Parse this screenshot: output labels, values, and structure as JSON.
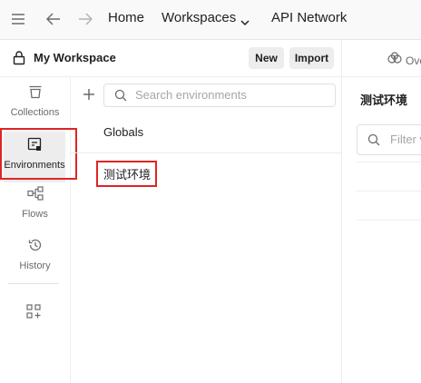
{
  "nav": {
    "home": "Home",
    "workspaces": "Workspaces",
    "api_network": "API Network"
  },
  "workspace": {
    "name": "My Workspace",
    "new_label": "New",
    "import_label": "Import"
  },
  "rail": {
    "items": [
      {
        "label": "Collections",
        "icon": "collections-icon"
      },
      {
        "label": "Environments",
        "icon": "environments-icon",
        "active": true
      },
      {
        "label": "Flows",
        "icon": "flows-icon"
      },
      {
        "label": "History",
        "icon": "history-icon"
      }
    ]
  },
  "search": {
    "placeholder": "Search environments"
  },
  "environments": {
    "items": [
      "Globals",
      "测试环境"
    ]
  },
  "right_panel": {
    "tab_label": "Ove",
    "title": "测试环境",
    "filter_placeholder": "Filter v"
  },
  "colors": {
    "highlight": "#e02424",
    "active_bg": "#ededed"
  }
}
